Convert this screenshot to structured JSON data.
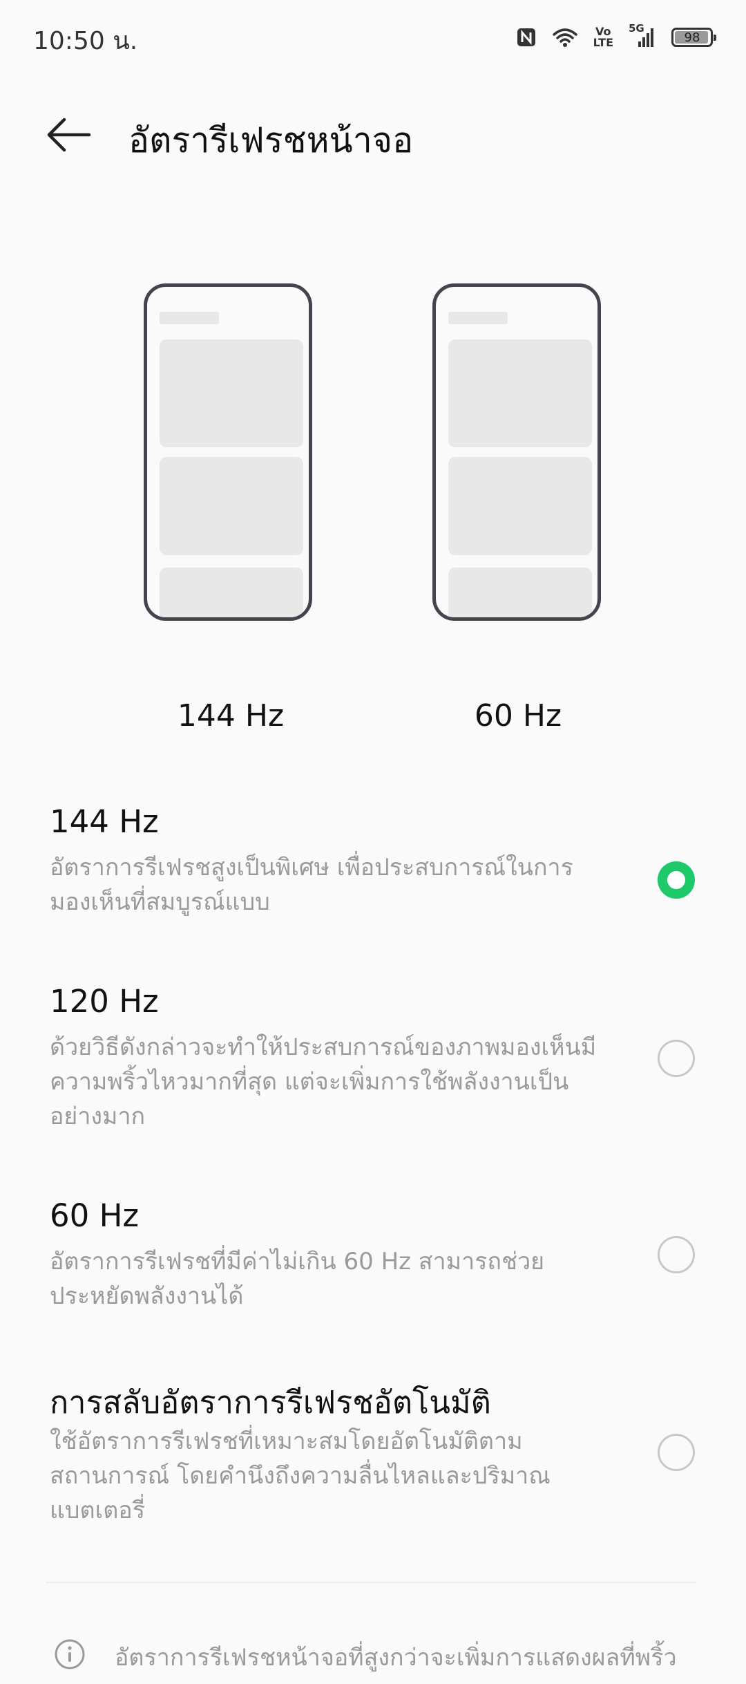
{
  "status_bar": {
    "time": "10:50 น.",
    "volte_top": "Vo",
    "volte_bottom": "LTE",
    "network": "5G",
    "battery": "98"
  },
  "header": {
    "title": "อัตรารีเฟรชหน้าจอ"
  },
  "preview": {
    "left_label": "144 Hz",
    "right_label": "60 Hz"
  },
  "options": [
    {
      "title": "144 Hz",
      "description": "อัตราการรีเฟรชสูงเป็นพิเศษ เพื่อประสบการณ์ในการมองเห็นที่สมบูรณ์แบบ",
      "selected": true
    },
    {
      "title": "120 Hz",
      "description": "ด้วยวิธีดังกล่าวจะทำให้ประสบการณ์ของภาพมองเห็นมีความพริ้วไหวมากที่สุด แต่จะเพิ่มการใช้พลังงานเป็นอย่างมาก",
      "selected": false
    },
    {
      "title": "60 Hz",
      "description": "อัตราการรีเฟรชที่มีค่าไม่เกิน 60 Hz สามารถช่วยประหยัดพลังงานได้",
      "selected": false
    },
    {
      "title": "การสลับอัตราการรีเฟรชอัตโนมัติ",
      "description": "ใช้อัตราการรีเฟรชที่เหมาะสมโดยอัตโนมัติตามสถานการณ์ โดยคำนึงถึงความลื่นไหลและปริมาณแบตเตอรี่",
      "selected": false
    }
  ],
  "info": {
    "text": "อัตราการรีเฟรชหน้าจอที่สูงกว่าจะเพิ่มการแสดงผลที่พริ้ว"
  },
  "colors": {
    "accent": "#1ec96a",
    "secondary_text": "#9a9a9a"
  }
}
